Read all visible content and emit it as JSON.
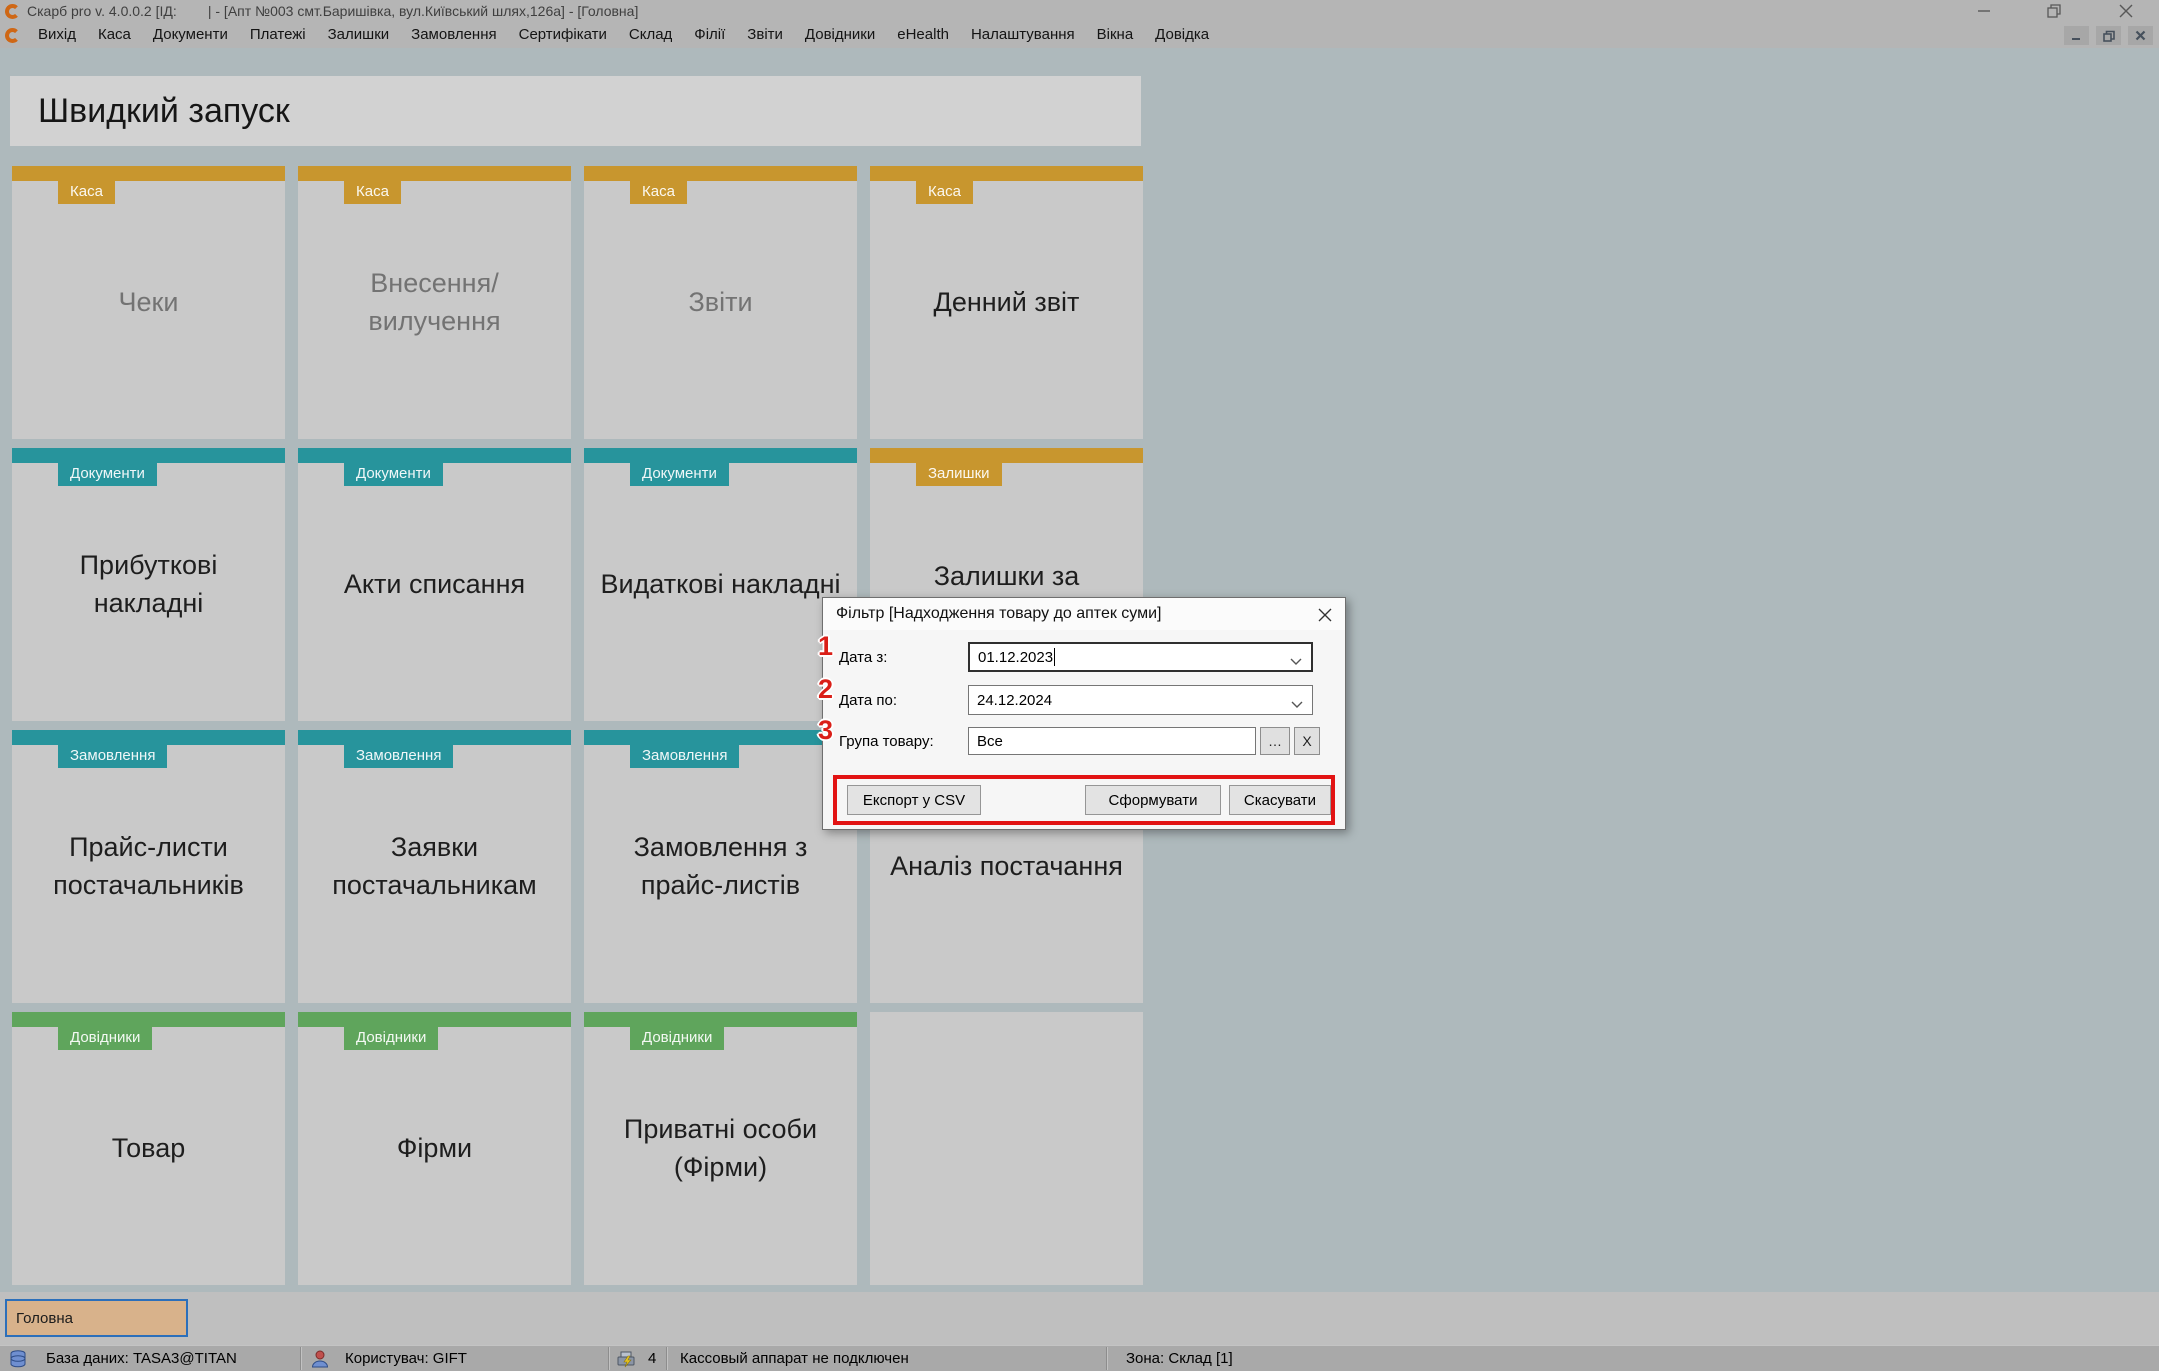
{
  "colors": {
    "gold": "#c8962e",
    "teal": "#27949c",
    "green": "#5fa55c",
    "tile_bg": "#c9c9c9",
    "content_bg": "#aeb9bc",
    "chrome_bg": "#b5b5b5",
    "panel_bg": "#d2d2d2",
    "footer_bg": "#bfbfbf",
    "status_bg": "#a9a9a9",
    "tab_bg": "#d8b28b",
    "tab_border": "#2c6fba",
    "annotation_red": "#da1f18"
  },
  "window": {
    "title": "Скарб pro v. 4.0.0.2 [ІД:        | - [Апт №003 смт.Баришівка, вул.Київський шлях,126а] - [Головна]"
  },
  "menu": {
    "items": [
      "Вихід",
      "Каса",
      "Документи",
      "Платежі",
      "Залишки",
      "Замовлення",
      "Сертифікати",
      "Склад",
      "Філії",
      "Звіти",
      "Довідники",
      "eHealth",
      "Налаштування",
      "Вікна",
      "Довідка"
    ]
  },
  "icons": {
    "app_logo": "orange-ring-logo",
    "minimize": "minimize-line",
    "restore": "overlapping-squares",
    "close": "x-cross",
    "combo_dropdown": "chevron-down",
    "database": "database-cylinder",
    "user": "person",
    "cash_register": "receipt-printer-lightning"
  },
  "quick_launch": {
    "title": "Швидкий запуск",
    "tiles": [
      {
        "category": "Каса",
        "label": "Чеки"
      },
      {
        "category": "Каса",
        "label": "Внесення/вилучення"
      },
      {
        "category": "Каса",
        "label": "Звіти"
      },
      {
        "category": "Каса",
        "label": "Денний звіт"
      },
      {
        "category": "Документи",
        "label": "Прибуткові накладні"
      },
      {
        "category": "Документи",
        "label": "Акти списання"
      },
      {
        "category": "Документи",
        "label": "Видаткові накладні"
      },
      {
        "category": "Залишки",
        "label": "Залишки за"
      },
      {
        "category": "Замовлення",
        "label": "Прайс-листи постачальників"
      },
      {
        "category": "Замовлення",
        "label": "Заявки постачальникам"
      },
      {
        "category": "Замовлення",
        "label": "Замовлення з прайс-листів"
      },
      {
        "category": "",
        "label": "Аналіз постачання"
      },
      {
        "category": "Довідники",
        "label": "Товар"
      },
      {
        "category": "Довідники",
        "label": "Фірми"
      },
      {
        "category": "Довідники",
        "label": "Приватні особи (Фірми)"
      },
      {
        "category": "",
        "label": ""
      }
    ]
  },
  "dialog": {
    "title": "Фільтр [Надходження товару до аптек суми]",
    "fields": [
      {
        "label": "Дата з:",
        "value": "01.12.2023"
      },
      {
        "label": "Дата по:",
        "value": "24.12.2024"
      },
      {
        "label": "Група товару:",
        "value": "Все",
        "browse": "…",
        "clear": "X"
      }
    ],
    "buttons": {
      "export": "Експорт у CSV",
      "generate": "Сформувати",
      "cancel": "Скасувати"
    },
    "annotations": [
      "1",
      "2",
      "3"
    ]
  },
  "footer": {
    "tab": "Головна",
    "status": {
      "database": "База даних: TASA3@TITAN",
      "user": "Користувач: GIFT",
      "count": "4",
      "cash_register": "Кассовый аппарат не подключен",
      "zone": "Зона: Склад [1]"
    }
  }
}
